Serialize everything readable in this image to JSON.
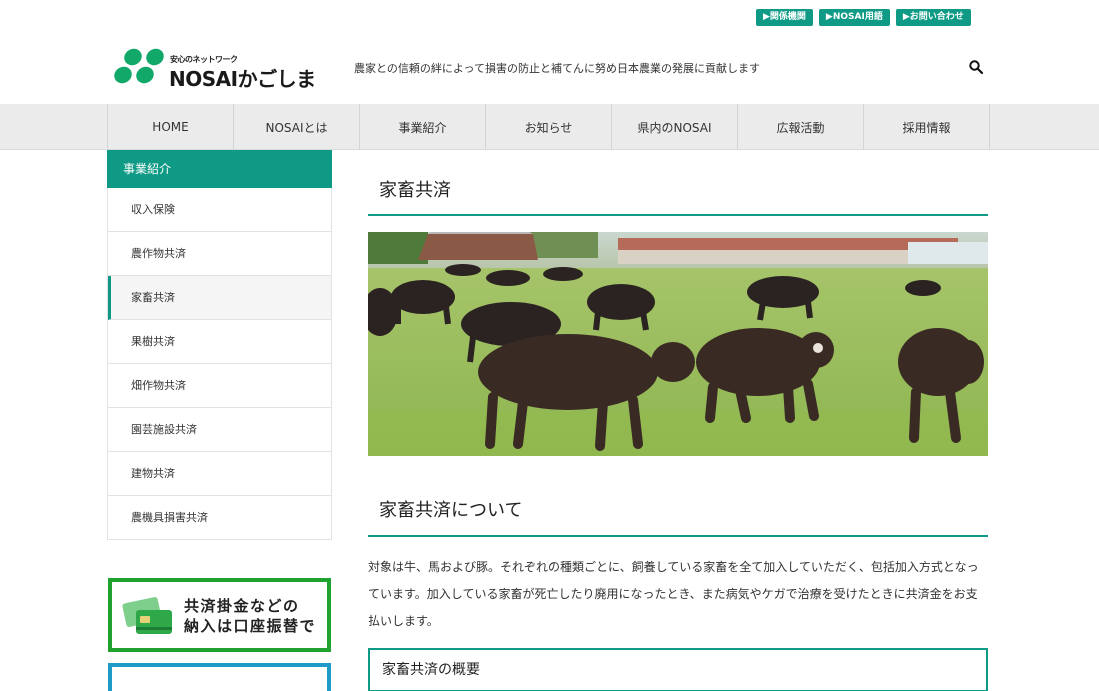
{
  "top_links": [
    "▶関係機関",
    "▶NOSAI用語",
    "▶お問い合わせ"
  ],
  "logo": {
    "small": "安心のネットワーク",
    "main": "NOSAIかごしま"
  },
  "tagline": "農家との信頼の絆によって損害の防止と補てんに努め日本農業の発展に貢献します",
  "nav": [
    "HOME",
    "NOSAIとは",
    "事業紹介",
    "お知らせ",
    "県内のNOSAI",
    "広報活動",
    "採用情報"
  ],
  "sidebar": {
    "title": "事業紹介",
    "items": [
      "収入保険",
      "農作物共済",
      "家畜共済",
      "果樹共済",
      "畑作物共済",
      "園芸施設共済",
      "建物共済",
      "農機具損害共済"
    ],
    "active_index": 2
  },
  "banner": {
    "line1": "共済掛金などの",
    "line2": "納入は口座振替で"
  },
  "main": {
    "title": "家畜共済",
    "section_title": "家畜共済について",
    "paragraph": "対象は牛、馬および豚。それぞれの種類ごとに、飼養している家畜を全て加入していただく、包括加入方式となっています。加入している家畜が死亡したり廃用になったとき、また病気やケガで治療を受けたときに共済金をお支払いします。",
    "box_title": "家畜共済の概要"
  },
  "colors": {
    "accent": "#0e9a84",
    "banner_green": "#1fa22e",
    "banner_blue": "#1f9bc7"
  }
}
